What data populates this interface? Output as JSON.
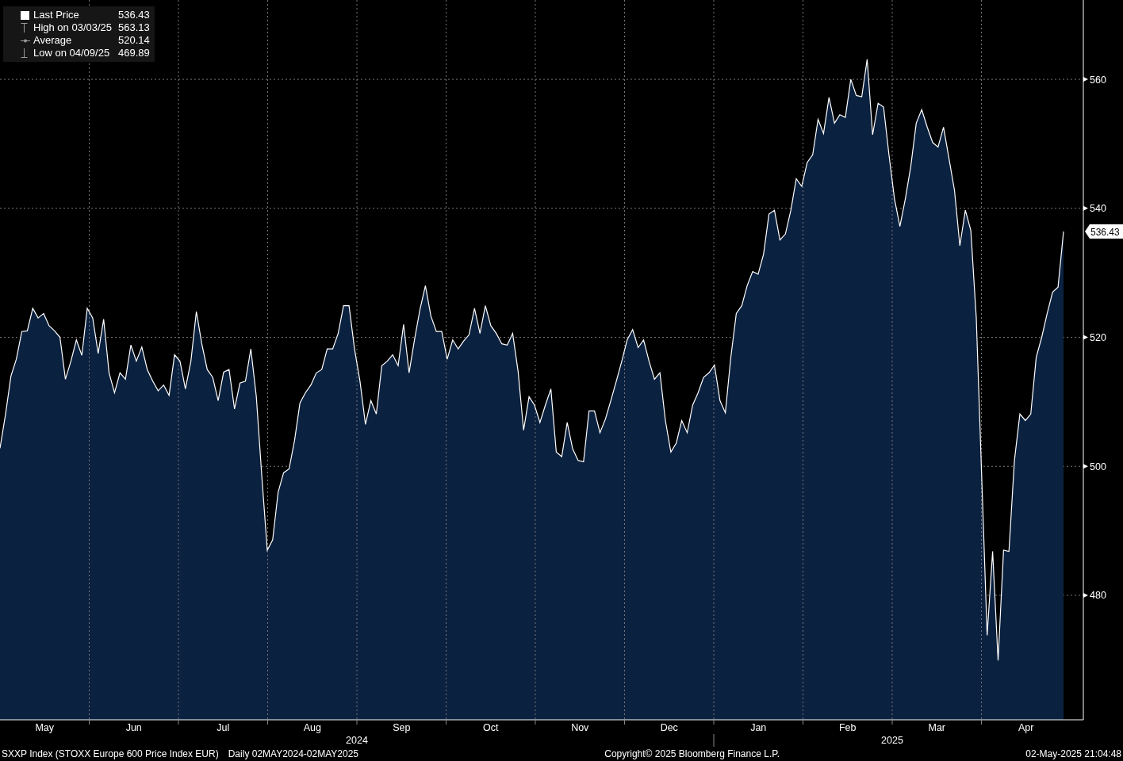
{
  "chart": {
    "legend": [
      {
        "kind": "last",
        "value": "536.43"
      },
      {
        "kind": "high",
        "label": "High on 03/03/25",
        "value": "563.13"
      },
      {
        "kind": "average",
        "label": "Average",
        "value": "520.14"
      },
      {
        "kind": "low",
        "label": "Low on 04/09/25",
        "value": "469.89"
      }
    ],
    "last_price_tag": "536.43",
    "x_axis": {
      "years": [
        {
          "label": "2024",
          "months": [
            "May",
            "Jun",
            "Jul",
            "Aug",
            "Sep",
            "Oct",
            "Nov",
            "Dec"
          ]
        },
        {
          "label": "2025",
          "months": [
            "Jan",
            "Feb",
            "Mar",
            "Apr"
          ]
        }
      ]
    },
    "chart_data": {
      "type": "area",
      "grid": true,
      "ylim": [
        460.7,
        572.3
      ],
      "yticks": [
        480,
        500,
        520,
        540,
        560
      ],
      "series": [
        {
          "name": "Last Price",
          "color": "#ffffff",
          "values": [
            502.8,
            508,
            514,
            516.6,
            520.9,
            521,
            524.5,
            523,
            523.7,
            521.8,
            521,
            520,
            513.5,
            516.3,
            519.6,
            517.2,
            524.5,
            523,
            517.5,
            522.8,
            514.5,
            511.4,
            514.5,
            513.5,
            518.8,
            516.3,
            518.5,
            515,
            513.2,
            511.7,
            512.6,
            511,
            517.3,
            516.3,
            512,
            516.3,
            524,
            519,
            515,
            513.8,
            510.2,
            514.6,
            515,
            508.9,
            512.9,
            513.2,
            518.2,
            510.8,
            498.5,
            487,
            488.6,
            496,
            499,
            499.6,
            504,
            509.8,
            511.4,
            512.6,
            514.5,
            515,
            518.2,
            518.2,
            520.6,
            524.9,
            524.9,
            518.2,
            513.2,
            506.5,
            510.2,
            508.1,
            515.6,
            516.3,
            517.3,
            515.6,
            522,
            514.5,
            519.6,
            524.3,
            528,
            523.3,
            520.9,
            520.9,
            516.6,
            519.6,
            518.2,
            519.4,
            520.4,
            524.5,
            520.6,
            524.9,
            521.8,
            520.6,
            519,
            518.8,
            520.6,
            514.7,
            505.6,
            510.8,
            509.5,
            506.8,
            509.5,
            512,
            502.2,
            501.5,
            506.8,
            502.7,
            500.9,
            500.7,
            508.6,
            508.6,
            505.2,
            507.3,
            510.2,
            513.2,
            516.3,
            519.6,
            521.2,
            518.4,
            519.6,
            516.3,
            513.5,
            514.5,
            507.1,
            502.2,
            503.6,
            507.1,
            505.2,
            509.5,
            511.4,
            513.8,
            514.5,
            515.7,
            510.2,
            508.3,
            516.9,
            523.7,
            524.9,
            528,
            530.2,
            529.8,
            532.9,
            539.1,
            539.7,
            535.1,
            536,
            539.7,
            544.6,
            543.4,
            547.1,
            548.3,
            553.8,
            551.6,
            557.2,
            553.2,
            554.5,
            554.1,
            560,
            557.5,
            557.3,
            563.1,
            551.4,
            556.3,
            555.7,
            548.3,
            541.5,
            537.2,
            541.5,
            546.5,
            553.2,
            555.3,
            552.6,
            550.2,
            549.5,
            552.6,
            547.7,
            542.8,
            534.2,
            539.7,
            536.6,
            523,
            498.5,
            473.8,
            486.8,
            469.9,
            487,
            486.8,
            500.9,
            508.1,
            507.1,
            508.1,
            516.9,
            520,
            523.7,
            527,
            527.8,
            536.4
          ]
        }
      ]
    }
  },
  "footer": {
    "security": "SXXP Index (STOXX Europe 600 Price Index EUR)",
    "period": "Daily 02MAY2024-02MAY2025",
    "copyright": "Copyright© 2025 Bloomberg Finance L.P.",
    "timestamp": "02-May-2025 21:04:48"
  }
}
